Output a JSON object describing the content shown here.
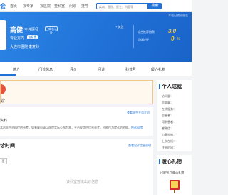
{
  "topnav": {
    "logo_fragment": "会",
    "links": [
      "首页",
      "找专家",
      "找医院",
      "查科室",
      "问诊",
      "挂号"
    ],
    "search_placeholder": "疾病、医院、医生、科室等",
    "search_button": "搜索"
  },
  "header": {
    "top_link": "| 本站已收录医生",
    "doctor_name": "高健",
    "doctor_title": "主任医师",
    "verified_badge": "已实名认证",
    "specialty_label": "专业方向",
    "specialty_tag": "查看更多",
    "hospital": "大连市医院",
    "department": "康复科",
    "follow_label": "+ 关注",
    "stats": [
      {
        "label": "综合推荐指数",
        "value": "3.0"
      },
      {
        "label": "总体好评",
        "value": "0"
      }
    ],
    "percent": "%"
  },
  "tabs": [
    "简介",
    "门诊信息",
    "评价",
    "问诊",
    "科普号",
    "暖心礼物"
  ],
  "notice": {
    "text": "诊"
  },
  "info": {
    "link": "查看医生主页介绍",
    "tag": "资料",
    "body": "本站医生资料仅供参考，如有疑问请以医院实际公布为准，平台仅提供信息参考，不能作为就诊的依据。",
    "more": "投诉纠错"
  },
  "schedule": {
    "title": "诊时间",
    "link": "查看出诊信息说明",
    "button": "更",
    "empty": "该科室暂无出诊信息"
  },
  "achievements": {
    "title": "个人成就",
    "rows": [
      "访问量：",
      "总文章：",
      "在线服务：",
      "总患者：",
      "得到患者：",
      "感谢信：",
      "心意礼物：",
      "上次在线：",
      "注册时间："
    ]
  },
  "gift": {
    "title": "暖心礼物",
    "subtitle": "已收到 个暖心礼物",
    "icon": "gift-icon",
    "item": "锦旗"
  },
  "colors": {
    "brand_blue": "#1e73d8",
    "header_gradient_start": "#2c86e6",
    "stat_gold": "#ffc940",
    "notice_border": "#f3c78a",
    "alert_red": "#e8513a"
  }
}
